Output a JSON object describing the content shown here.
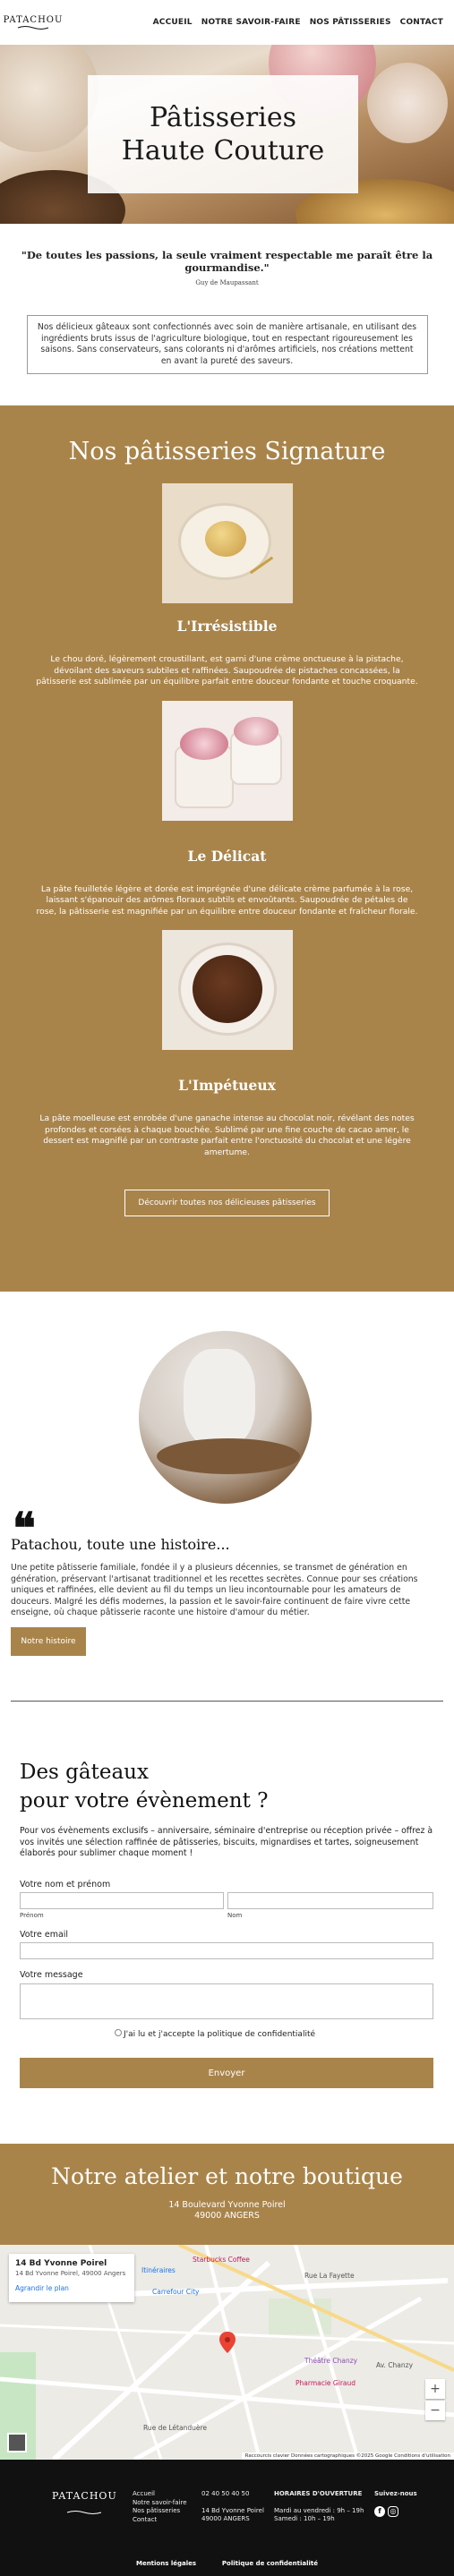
{
  "header": {
    "logo_text": "PATACHOU",
    "nav": [
      "ACCUEIL",
      "NOTRE SAVOIR-FAIRE",
      "NOS PÂTISSERIES",
      "CONTACT"
    ]
  },
  "hero": {
    "title_line1": "Pâtisseries",
    "title_line2": "Haute Couture"
  },
  "quote": {
    "text": "\"De toutes les passions, la seule vraiment respectable me paraît être la gourmandise.\"",
    "author": "Guy de Maupassant"
  },
  "intro": "Nos délicieux gâteaux sont confectionnés avec soin de manière artisanale, en utilisant des ingrédients bruts issus de l'agriculture biologique, tout en respectant rigoureusement les saisons. Sans conservateurs, sans colorants ni d'arômes artificiels, nos créations mettent en avant la pureté des saveurs.",
  "signature": {
    "title": "Nos pâtisseries Signature",
    "items": [
      {
        "name": "L'Irrésistible",
        "description": "Le chou doré, légèrement croustillant, est garni d'une crème onctueuse à la pistache, dévoilant des saveurs subtiles et raffinées. Saupoudrée de pistaches concassées, la pâtisserie est sublimée par un équilibre parfait entre douceur fondante et touche croquante."
      },
      {
        "name": "Le Délicat",
        "description": "La pâte feuilletée légère et dorée est imprégnée d'une délicate crème parfumée à la rose, laissant s'épanouir des arômes floraux subtils et envoûtants. Saupoudrée de pétales de rose, la pâtisserie est magnifiée par un équilibre entre douceur fondante et fraîcheur florale."
      },
      {
        "name": "L'Impétueux",
        "description": "La pâte moelleuse est enrobée d'une ganache intense au chocolat noir, révélant des notes profondes et corsées à chaque bouchée. Sublimé par une fine couche de cacao amer, le dessert est magnifié par un contraste parfait entre l'onctuosité du chocolat et une légère amertume."
      }
    ],
    "button": "Découvrir toutes nos délicieuses pâtisseries"
  },
  "story": {
    "quote_mark": "❝",
    "title": "Patachou, toute une histoire...",
    "text": "Une petite pâtisserie familiale, fondée il y a plusieurs décennies, se transmet de génération en génération, préservant l'artisanat traditionnel et les recettes secrètes. Connue pour ses créations uniques et raffinées, elle devient au fil du temps un lieu incontournable pour les amateurs de douceurs. Malgré les défis modernes, la passion et le savoir-faire continuent de faire vivre cette enseigne, où chaque pâtisserie raconte une histoire d'amour du métier.",
    "button": "Notre histoire"
  },
  "event": {
    "title_line1": "Des gâteaux",
    "title_line2": "pour votre évènement ?",
    "text": "Pour vos évènements exclusifs – anniversaire, séminaire d'entreprise ou réception privée – offrez à vos invités une sélection raffinée de pâtisseries, biscuits, mignardises et tartes, soigneusement élaborés pour sublimer chaque moment !",
    "name_label": "Votre nom et prénom",
    "firstname_sub": "Prénom",
    "lastname_sub": "Nom",
    "email_label": "Votre email",
    "message_label": "Votre message",
    "privacy": "J'ai lu et j'accepte la politique de confidentialité",
    "submit": "Envoyer"
  },
  "atelier": {
    "title": "Notre atelier et notre boutique",
    "address_line1": "14 Boulevard Yvonne Poirel",
    "address_line2": "49000 ANGERS"
  },
  "map": {
    "card_title": "14 Bd Yvonne Poirel",
    "card_address": "14 Bd Yvonne Poirel, 49000 Angers",
    "directions": "Itinéraires",
    "enlarge": "Agrandir le plan",
    "labels": {
      "l1": "Starbucks Coffee",
      "l2": "Carrefour City",
      "l3": "Rue La Fayette",
      "l4": "Théâtre Chanzy",
      "l5": "Pharmacie Giraud",
      "l6": "Av. Chanzy",
      "l7": "Rue de Létanduère"
    },
    "attribution": "Raccourcis clavier   Données cartographiques ©2025 Google   Conditions d'utilisation",
    "zoom_in": "+",
    "zoom_out": "−"
  },
  "footer": {
    "logo": "PATACHOU",
    "nav": [
      "Accueil",
      "Notre savoir-faire",
      "Nos pâtisseries",
      "Contact"
    ],
    "phone": "02 40 50 40 50",
    "address_line1": "14 Bd Yvonne Poirel",
    "address_line2": "49000 ANGERS",
    "hours_title": "HORAIRES D'OUVERTURE",
    "hours_1": "Mardi au vendredi : 9h – 19h",
    "hours_2": "Samedi : 10h – 19h",
    "follow": "Suivez-nous",
    "legal_1": "Mentions légales",
    "legal_2": "Politique de confidentialité"
  }
}
